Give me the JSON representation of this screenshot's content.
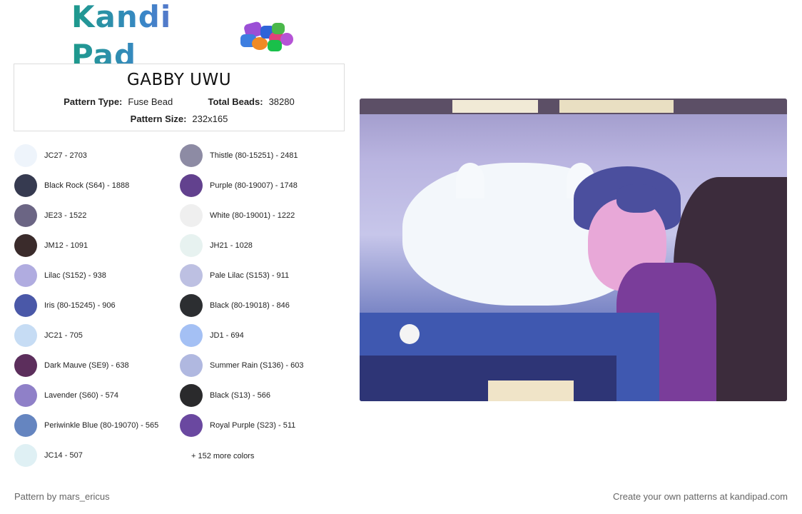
{
  "brand": {
    "name": "Kandi Pad"
  },
  "pattern": {
    "title": "GABBY UWU",
    "type_label": "Pattern Type:",
    "type_value": "Fuse Bead",
    "beads_label": "Total Beads:",
    "beads_value": "38280",
    "size_label": "Pattern Size:",
    "size_value": "232x165"
  },
  "colors_left": [
    {
      "label": "JC27 - 2703",
      "hex": "#eef4fb"
    },
    {
      "label": "Black Rock (S64) - 1888",
      "hex": "#363a50"
    },
    {
      "label": "JE23 - 1522",
      "hex": "#6b6584"
    },
    {
      "label": "JM12 - 1091",
      "hex": "#3a2b2b"
    },
    {
      "label": "Lilac (S152) - 938",
      "hex": "#b0ace0"
    },
    {
      "label": "Iris (80-15245) - 906",
      "hex": "#4a58a8"
    },
    {
      "label": "JC21 - 705",
      "hex": "#c6dcf4"
    },
    {
      "label": "Dark Mauve (SE9) - 638",
      "hex": "#5c2e5c"
    },
    {
      "label": "Lavender (S60) - 574",
      "hex": "#8f80c8"
    },
    {
      "label": "Periwinkle Blue (80-19070) - 565",
      "hex": "#6585c0"
    },
    {
      "label": "JC14 - 507",
      "hex": "#dff0f4"
    }
  ],
  "colors_right": [
    {
      "label": "Thistle (80-15251) - 2481",
      "hex": "#8d8ba4"
    },
    {
      "label": "Purple (80-19007) - 1748",
      "hex": "#62418e"
    },
    {
      "label": "White (80-19001) - 1222",
      "hex": "#efefef"
    },
    {
      "label": "JH21 - 1028",
      "hex": "#e7f2f0"
    },
    {
      "label": "Pale Lilac (S153) - 911",
      "hex": "#bdc0e2"
    },
    {
      "label": "Black (80-19018) - 846",
      "hex": "#2c2e31"
    },
    {
      "label": "JD1 - 694",
      "hex": "#a4c0f4"
    },
    {
      "label": "Summer Rain (S136) - 603",
      "hex": "#b0b8e0"
    },
    {
      "label": "Black (S13) - 566",
      "hex": "#2a2a2c"
    },
    {
      "label": "Royal Purple (S23) - 511",
      "hex": "#6a48a0"
    }
  ],
  "more_colors": "+ 152 more colors",
  "footer": {
    "credit": "Pattern by mars_ericus",
    "cta": "Create your own patterns at kandipad.com"
  }
}
